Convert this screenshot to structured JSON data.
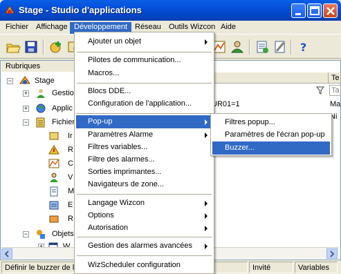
{
  "window": {
    "title": "Stage - Studio d'applications",
    "controls": [
      "minimize-icon",
      "maximize-icon",
      "close-icon"
    ]
  },
  "menubar": {
    "items": [
      {
        "label": "Fichier"
      },
      {
        "label": "Affichage"
      },
      {
        "label": "Développement",
        "active": true
      },
      {
        "label": "Réseau"
      },
      {
        "label": "Outils Wizcon"
      },
      {
        "label": "Aide"
      }
    ]
  },
  "toolbar": {
    "icons": [
      "open-folder-icon",
      "save-icon",
      "add-icon",
      "properties-icon",
      "chart-icon",
      "users-icon",
      "document-icon",
      "tools-icon",
      "help-icon"
    ]
  },
  "pane": {
    "header": "Rubriques",
    "tree": [
      {
        "label": "Stage",
        "icon": "project-icon"
      },
      {
        "label": "Gestio",
        "icon": "users-icon"
      },
      {
        "label": "Applic",
        "icon": "globe-icon"
      },
      {
        "label": "Fichier",
        "icon": "files-icon"
      },
      {
        "label": "Ir",
        "icon": "tag-icon"
      },
      {
        "label": "R",
        "icon": "alarm-icon"
      },
      {
        "label": "C",
        "icon": "chart-icon"
      },
      {
        "label": "V",
        "icon": "user-icon"
      },
      {
        "label": "M",
        "icon": "document-icon"
      },
      {
        "label": "E",
        "icon": "event-icon"
      },
      {
        "label": "R",
        "icon": "report-icon"
      },
      {
        "label": "Objets",
        "icon": "objects-icon"
      },
      {
        "label": "W",
        "icon": "window-icon"
      }
    ],
    "right_header": "Te",
    "filter_text": "Ta",
    "cells": [
      "UR01=1",
      "Ma",
      "Ni"
    ]
  },
  "statusbar": {
    "message": "Définir le buzzer de l'",
    "user": "Invité",
    "variables": "Variables"
  },
  "dropdown": {
    "items": [
      {
        "label": "Ajouter un objet",
        "submenu": true
      },
      {
        "label": "Pilotes de communication..."
      },
      {
        "label": "Macros..."
      },
      {
        "label": "Blocs DDE..."
      },
      {
        "label": "Configuration de l'application..."
      },
      {
        "label": "Pop-up",
        "submenu": true,
        "highlighted": true
      },
      {
        "label": "Paramètres Alarme",
        "submenu": true
      },
      {
        "label": "Filtres variables..."
      },
      {
        "label": "Filtre des alarmes..."
      },
      {
        "label": "Sorties imprimantes..."
      },
      {
        "label": "Navigateurs de zone..."
      },
      {
        "label": "Langage Wizcon",
        "submenu": true
      },
      {
        "label": "Options",
        "submenu": true
      },
      {
        "label": "Autorisation",
        "submenu": true
      },
      {
        "label": "Gestion des alarmes avancées",
        "submenu": true
      },
      {
        "label": "WizScheduler configuration"
      }
    ]
  },
  "submenu": {
    "items": [
      {
        "label": "Filtres popup..."
      },
      {
        "label": "Paramètres de l'écran pop-up"
      },
      {
        "label": "Buzzer...",
        "highlighted": true
      }
    ]
  },
  "colors": {
    "titlebar": "#0450d8",
    "highlight": "#316ac5",
    "chrome": "#ece9d8"
  }
}
